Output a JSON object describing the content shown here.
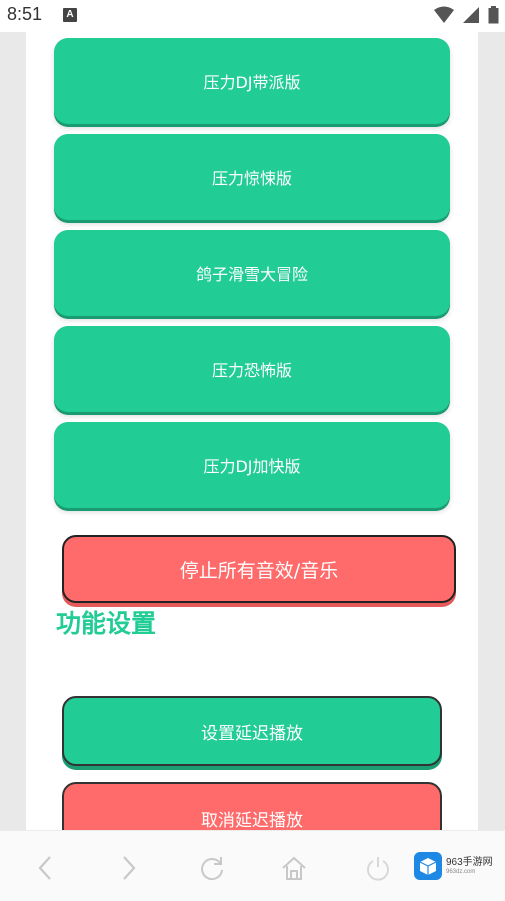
{
  "status_bar": {
    "time": "8:51",
    "notification_icon": "A"
  },
  "sound_buttons": [
    {
      "label": "压力DJ带派版"
    },
    {
      "label": "压力惊悚版"
    },
    {
      "label": "鸽子滑雪大冒险"
    },
    {
      "label": "压力恐怖版"
    },
    {
      "label": "压力DJ加快版"
    }
  ],
  "stop_button": {
    "label": "停止所有音效/音乐"
  },
  "settings_section": {
    "title": "功能设置",
    "set_delay_label": "设置延迟播放",
    "cancel_delay_label": "取消延迟播放"
  },
  "nav": {
    "items": [
      "back-icon",
      "forward-icon",
      "refresh-icon",
      "home-icon",
      "power-icon"
    ]
  },
  "watermark": {
    "brand": "963手游网",
    "site": "963dz.com"
  },
  "colors": {
    "green": "#22cc95",
    "red": "#ff6b6b",
    "section_title": "#22cc95"
  }
}
